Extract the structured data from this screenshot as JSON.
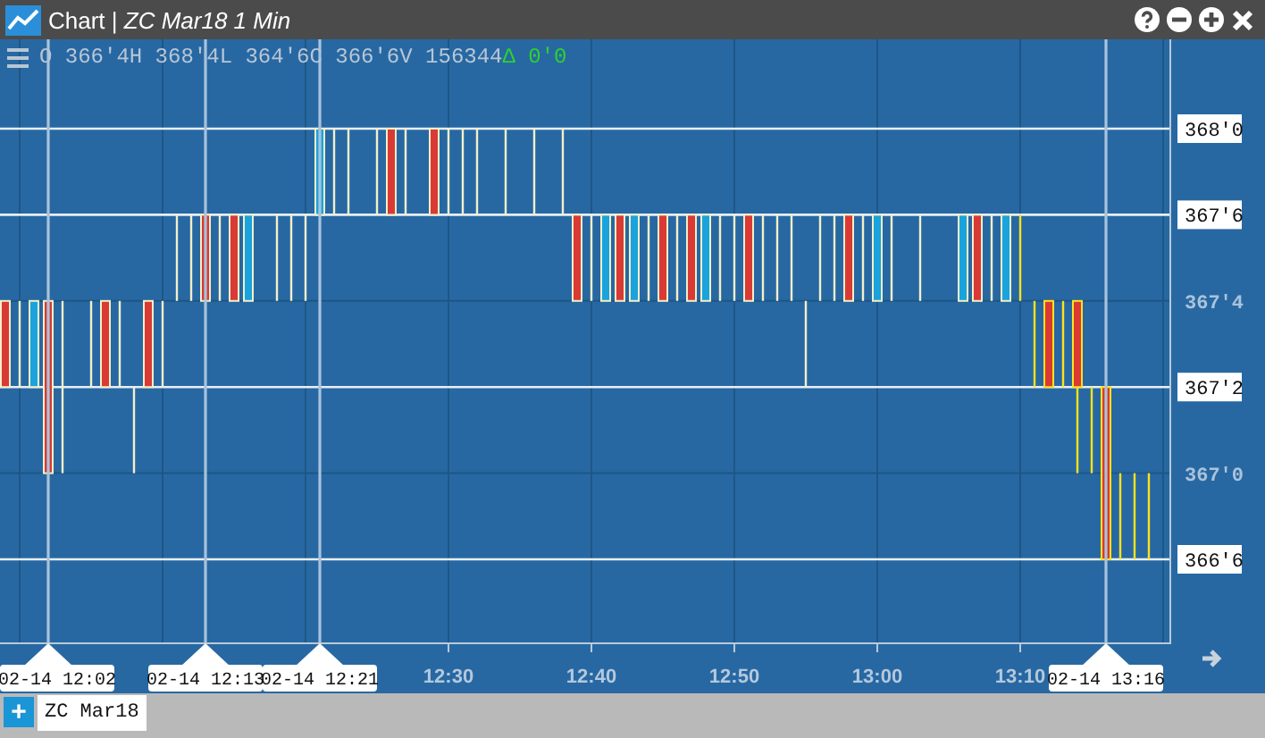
{
  "window": {
    "title": "Chart | *ZC Mar18 1 Min*"
  },
  "legend": {
    "values": "O 366'4H 368'4L 364'6C 366'6V 156344",
    "change": "Δ 0'0"
  },
  "chart": {
    "price_labels": [
      {
        "text": "368'0",
        "highlighted": true
      },
      {
        "text": "367'6",
        "highlighted": true
      },
      {
        "text": "367'4",
        "highlighted": false
      },
      {
        "text": "367'2",
        "highlighted": true
      },
      {
        "text": "367'0",
        "highlighted": false
      },
      {
        "text": "366'6",
        "highlighted": true
      }
    ],
    "time_labels": [
      "12:30",
      "12:40",
      "12:50",
      "13:00",
      "13:10"
    ],
    "crosshairs": [
      {
        "label": "02-14 12:02"
      },
      {
        "label": "02-14 12:13"
      },
      {
        "label": "02-14 12:21"
      },
      {
        "label": "02-14 13:16"
      }
    ]
  },
  "new_tab_button": "+",
  "tabs": [
    {
      "label": "ZC Mar18",
      "selected": true
    }
  ]
}
